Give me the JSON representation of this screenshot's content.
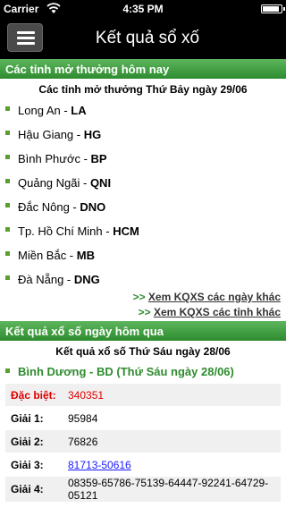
{
  "status_bar": {
    "carrier": "Carrier",
    "time": "4:35 PM"
  },
  "nav": {
    "title": "Kết quả sổ xố"
  },
  "today": {
    "header": "Các tỉnh mở thưởng hôm nay",
    "subtitle": "Các tỉnh mở thưởng Thứ Bảy ngày 29/06",
    "provinces": [
      {
        "name": "Long An - ",
        "code": "LA"
      },
      {
        "name": "Hậu Giang - ",
        "code": "HG"
      },
      {
        "name": "Bình Phước - ",
        "code": "BP"
      },
      {
        "name": "Quảng Ngãi - ",
        "code": "QNI"
      },
      {
        "name": "Đắc Nông - ",
        "code": "DNO"
      },
      {
        "name": "Tp. Hồ Chí Minh - ",
        "code": "HCM"
      },
      {
        "name": "Miền Bắc - ",
        "code": "MB"
      },
      {
        "name": "Đà Nẵng - ",
        "code": "DNG"
      }
    ],
    "links": [
      {
        "arrows": ">> ",
        "label": "Xem KQXS các ngày khác"
      },
      {
        "arrows": ">> ",
        "label": "Xem KQXS các tỉnh khác"
      }
    ]
  },
  "yesterday": {
    "header": "Kết quả xổ số ngày hôm qua",
    "subtitle": "Kết quả xổ số Thứ Sáu ngày 28/06",
    "province": "Bình Dương - BD (Thứ Sáu ngày 28/06)",
    "prizes": [
      {
        "label": "Đặc biệt:",
        "value": "340351"
      },
      {
        "label": "Giải 1:",
        "value": "95984"
      },
      {
        "label": "Giải 2:",
        "value": "76826"
      },
      {
        "label": "Giải 3:",
        "value": "81713-50616"
      },
      {
        "label": "Giải 4:",
        "value": "08359-65786-75139-64447-92241-64729-05121"
      }
    ]
  }
}
